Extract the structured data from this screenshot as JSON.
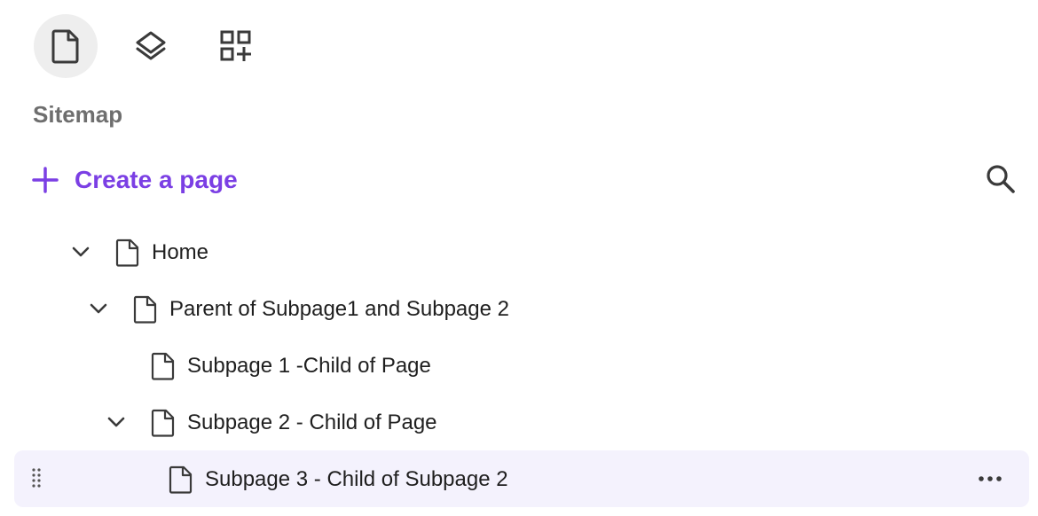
{
  "tabs": [
    {
      "icon": "document-icon",
      "active": true
    },
    {
      "icon": "layers-icon",
      "active": false
    },
    {
      "icon": "apps-add-icon",
      "active": false
    }
  ],
  "sitemap": {
    "title": "Sitemap",
    "create_label": "Create a page",
    "search_icon": "search-icon",
    "accent_color": "#7b3fe4"
  },
  "tree": [
    {
      "label": "Home",
      "depth": 0,
      "expanded": true
    },
    {
      "label": "Parent of Subpage1 and Subpage 2",
      "depth": 1,
      "expanded": true
    },
    {
      "label": "Subpage 1 -Child of Page",
      "depth": 2,
      "expanded": null
    },
    {
      "label": "Subpage 2 - Child of Page",
      "depth": 2,
      "expanded": true
    },
    {
      "label": "Subpage 3 - Child of Subpage 2",
      "depth": 3,
      "expanded": null,
      "selected": true
    }
  ]
}
